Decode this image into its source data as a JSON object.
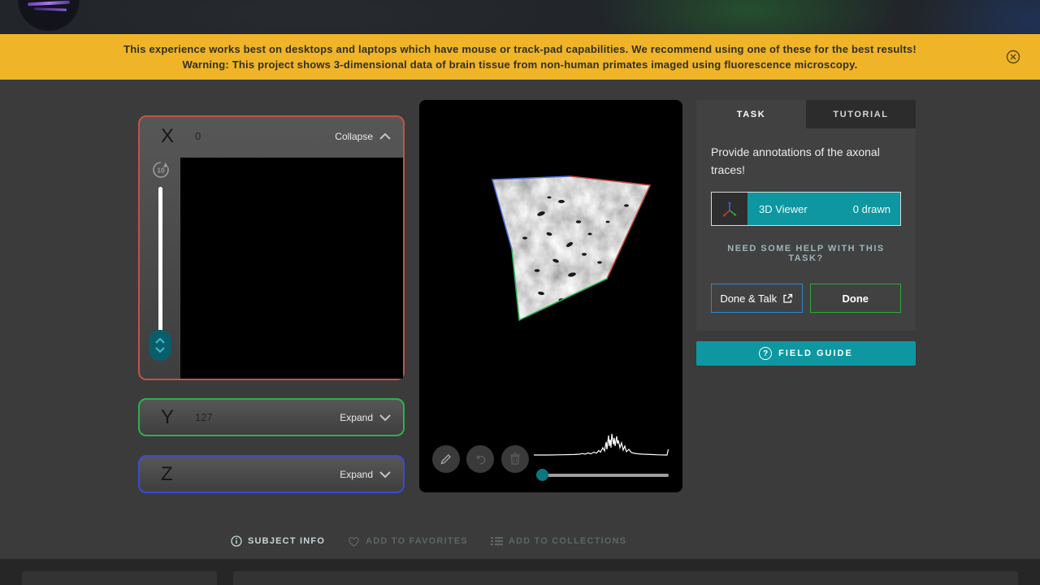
{
  "banner": {
    "line1": "This experience works best on desktops and laptops which have mouse or track-pad capabilities. We recommend using one of these for the best results!",
    "line2": "Warning: This project shows 3-dimensional data of brain tissue from non-human primates imaged using fluorescence microscopy."
  },
  "panels": {
    "x": {
      "label": "X",
      "value": "0",
      "toggle": "Collapse",
      "loop_icon_label": "10"
    },
    "y": {
      "label": "Y",
      "value": "127",
      "toggle": "Expand"
    },
    "z": {
      "label": "Z",
      "value": "",
      "toggle": "Expand"
    }
  },
  "task": {
    "tabs": [
      {
        "label": "TASK"
      },
      {
        "label": "TUTORIAL"
      }
    ],
    "instruction": "Provide annotations of the axonal traces!",
    "tool": {
      "label": "3D Viewer",
      "count": "0 drawn"
    },
    "help": "NEED SOME HELP WITH THIS TASK?",
    "buttons": {
      "done_talk": "Done & Talk",
      "done": "Done"
    }
  },
  "field_guide": {
    "label": "FIELD GUIDE",
    "icon": "?"
  },
  "footer": {
    "subject_info": "SUBJECT INFO",
    "add_favorites": "ADD TO FAVORITES",
    "add_collections": "ADD TO COLLECTIONS"
  },
  "colors": {
    "accent_teal": "#0E97A0",
    "banner_yellow": "#F0B429",
    "x_border_red": "#C05449",
    "y_border_green": "#2DB14C",
    "z_border_blue": "#3A4BD6",
    "done_talk_border_blue": "#2E86C8",
    "done_border_green": "#2FA83C",
    "edge_blue": "#5272D6",
    "edge_red": "#C14B41",
    "edge_green": "#2FAE54"
  }
}
